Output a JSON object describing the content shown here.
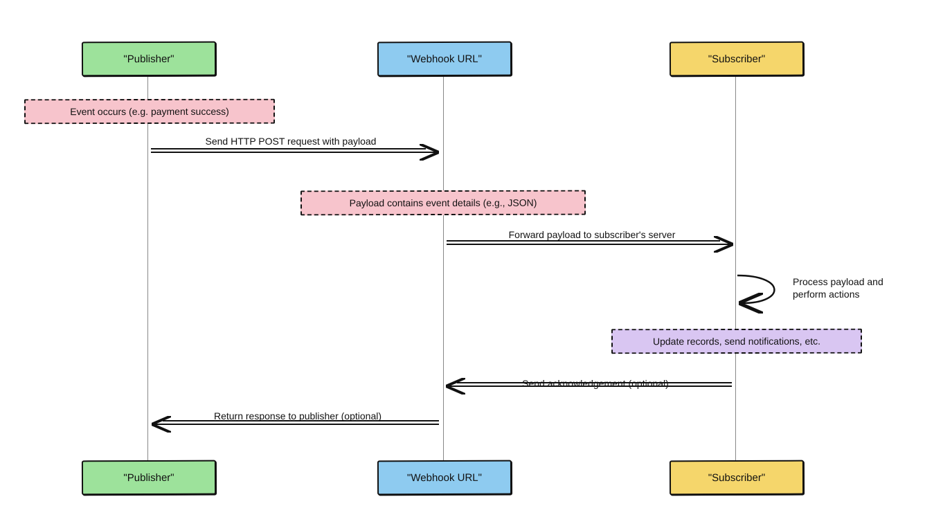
{
  "actors": {
    "publisher": "\"Publisher\"",
    "webhook": "\"Webhook URL\"",
    "subscriber": "\"Subscriber\""
  },
  "notes": {
    "event": "Event occurs (e.g. payment success)",
    "payload": "Payload contains event details (e.g., JSON)",
    "update": "Update records, send notifications, etc."
  },
  "messages": {
    "m1": "Send HTTP POST request with payload",
    "m2": "Forward payload to subscriber's server",
    "m3": "Process payload and perform actions",
    "m4": "Send acknowledgement (optional)",
    "m5": "Return response to publisher (optional)"
  }
}
